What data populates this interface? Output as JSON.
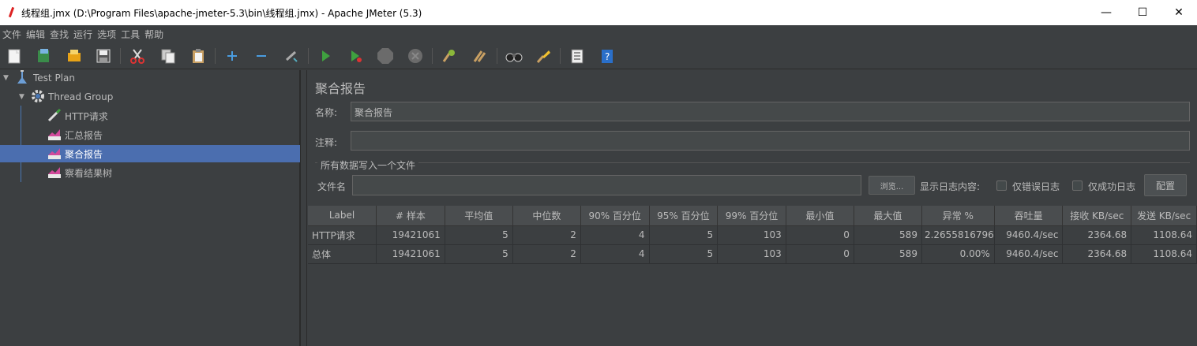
{
  "window": {
    "title": "线程组.jmx (D:\\Program Files\\apache-jmeter-5.3\\bin\\线程组.jmx) - Apache JMeter (5.3)",
    "minimize": "—",
    "maximize": "☐",
    "close": "✕"
  },
  "menu": [
    "文件",
    "编辑",
    "查找",
    "运行",
    "选项",
    "工具",
    "帮助"
  ],
  "toolbar": {
    "icons": [
      "new-icon",
      "templates-icon",
      "open-icon",
      "save-icon",
      "cut-icon",
      "copy-icon",
      "paste-icon",
      "expand-icon",
      "collapse-icon",
      "toggle-icon",
      "start-icon",
      "start-no-pause-icon",
      "stop-icon",
      "shutdown-icon",
      "clear-icon",
      "clear-all-icon",
      "search-icon",
      "reset-search-icon",
      "function-helper-icon",
      "help-icon"
    ]
  },
  "tree": {
    "test_plan": "Test Plan",
    "thread_group": "Thread Group",
    "items": [
      "HTTP请求",
      "汇总报告",
      "聚合报告",
      "察看结果树"
    ],
    "selected_index": 2
  },
  "panel": {
    "title": "聚合报告",
    "name_label": "名称:",
    "name_value": "聚合报告",
    "comment_label": "注释:",
    "comment_value": "",
    "file_section_title": "所有数据写入一个文件",
    "filename_label": "文件名",
    "filename_value": "",
    "browse_button": "浏览...",
    "log_label": "显示日志内容:",
    "errors_only": "仅错误日志",
    "success_only": "仅成功日志",
    "configure_button": "配置"
  },
  "table": {
    "headers": [
      "Label",
      "# 样本",
      "平均值",
      "中位数",
      "90% 百分位",
      "95% 百分位",
      "99% 百分位",
      "最小值",
      "最大值",
      "异常 %",
      "吞吐量",
      "接收 KB/sec",
      "发送 KB/sec"
    ],
    "rows": [
      [
        "HTTP请求",
        "19421061",
        "5",
        "2",
        "4",
        "5",
        "103",
        "0",
        "589",
        "2.2655816796",
        "9460.4/sec",
        "2364.68",
        "1108.64"
      ],
      [
        "总体",
        "19421061",
        "5",
        "2",
        "4",
        "5",
        "103",
        "0",
        "589",
        "0.00%",
        "9460.4/sec",
        "2364.68",
        "1108.64"
      ]
    ]
  },
  "colors": {
    "background": "#3c3f41",
    "selection": "#4b6eaf",
    "text": "#bbbbbb"
  }
}
